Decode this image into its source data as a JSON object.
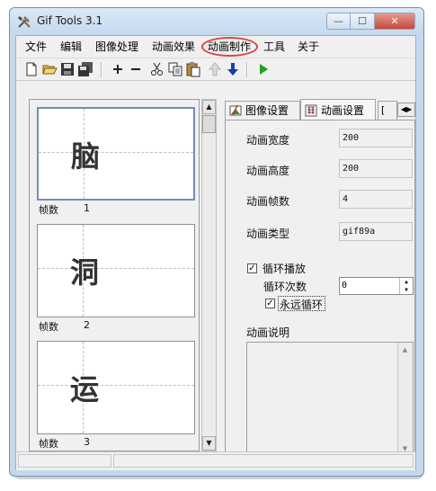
{
  "window": {
    "title": "Gif Tools 3.1",
    "min": "—",
    "max": "☐",
    "close": "✕"
  },
  "menu": [
    "文件",
    "编辑",
    "图像处理",
    "动画效果",
    "动画制作",
    "工具",
    "关于"
  ],
  "toolbar": {
    "icons": [
      "new-file-icon",
      "open-folder-icon",
      "save-icon",
      "save-all-icon",
      "add-icon",
      "remove-icon",
      "cut-icon",
      "copy-icon",
      "paste-icon",
      "move-up-icon",
      "move-down-icon",
      "play-icon"
    ]
  },
  "frames": [
    {
      "glyph": "脑",
      "label": "帧数",
      "number": "1"
    },
    {
      "glyph": "洞",
      "label": "帧数",
      "number": "2"
    },
    {
      "glyph": "运",
      "label": "帧数",
      "number": "3"
    }
  ],
  "tabs": [
    {
      "label": "图像设置"
    },
    {
      "label": "动画设置"
    }
  ],
  "anim": {
    "width_label": "动画宽度",
    "width_value": "200",
    "height_label": "动画高度",
    "height_value": "200",
    "frames_label": "动画帧数",
    "frames_value": "4",
    "type_label": "动画类型",
    "type_value": "gif89a",
    "loop_label": "循环播放",
    "loop_checked": true,
    "loop_count_label": "循环次数",
    "loop_count_value": "0",
    "forever_label": "永远循环",
    "forever_checked": true,
    "desc_label": "动画说明",
    "desc_value": ""
  },
  "colors": {
    "highlight": "#d9443f",
    "title_bg": "#c6d9ec",
    "accent": "#1a3ea8",
    "play": "#20a020"
  }
}
